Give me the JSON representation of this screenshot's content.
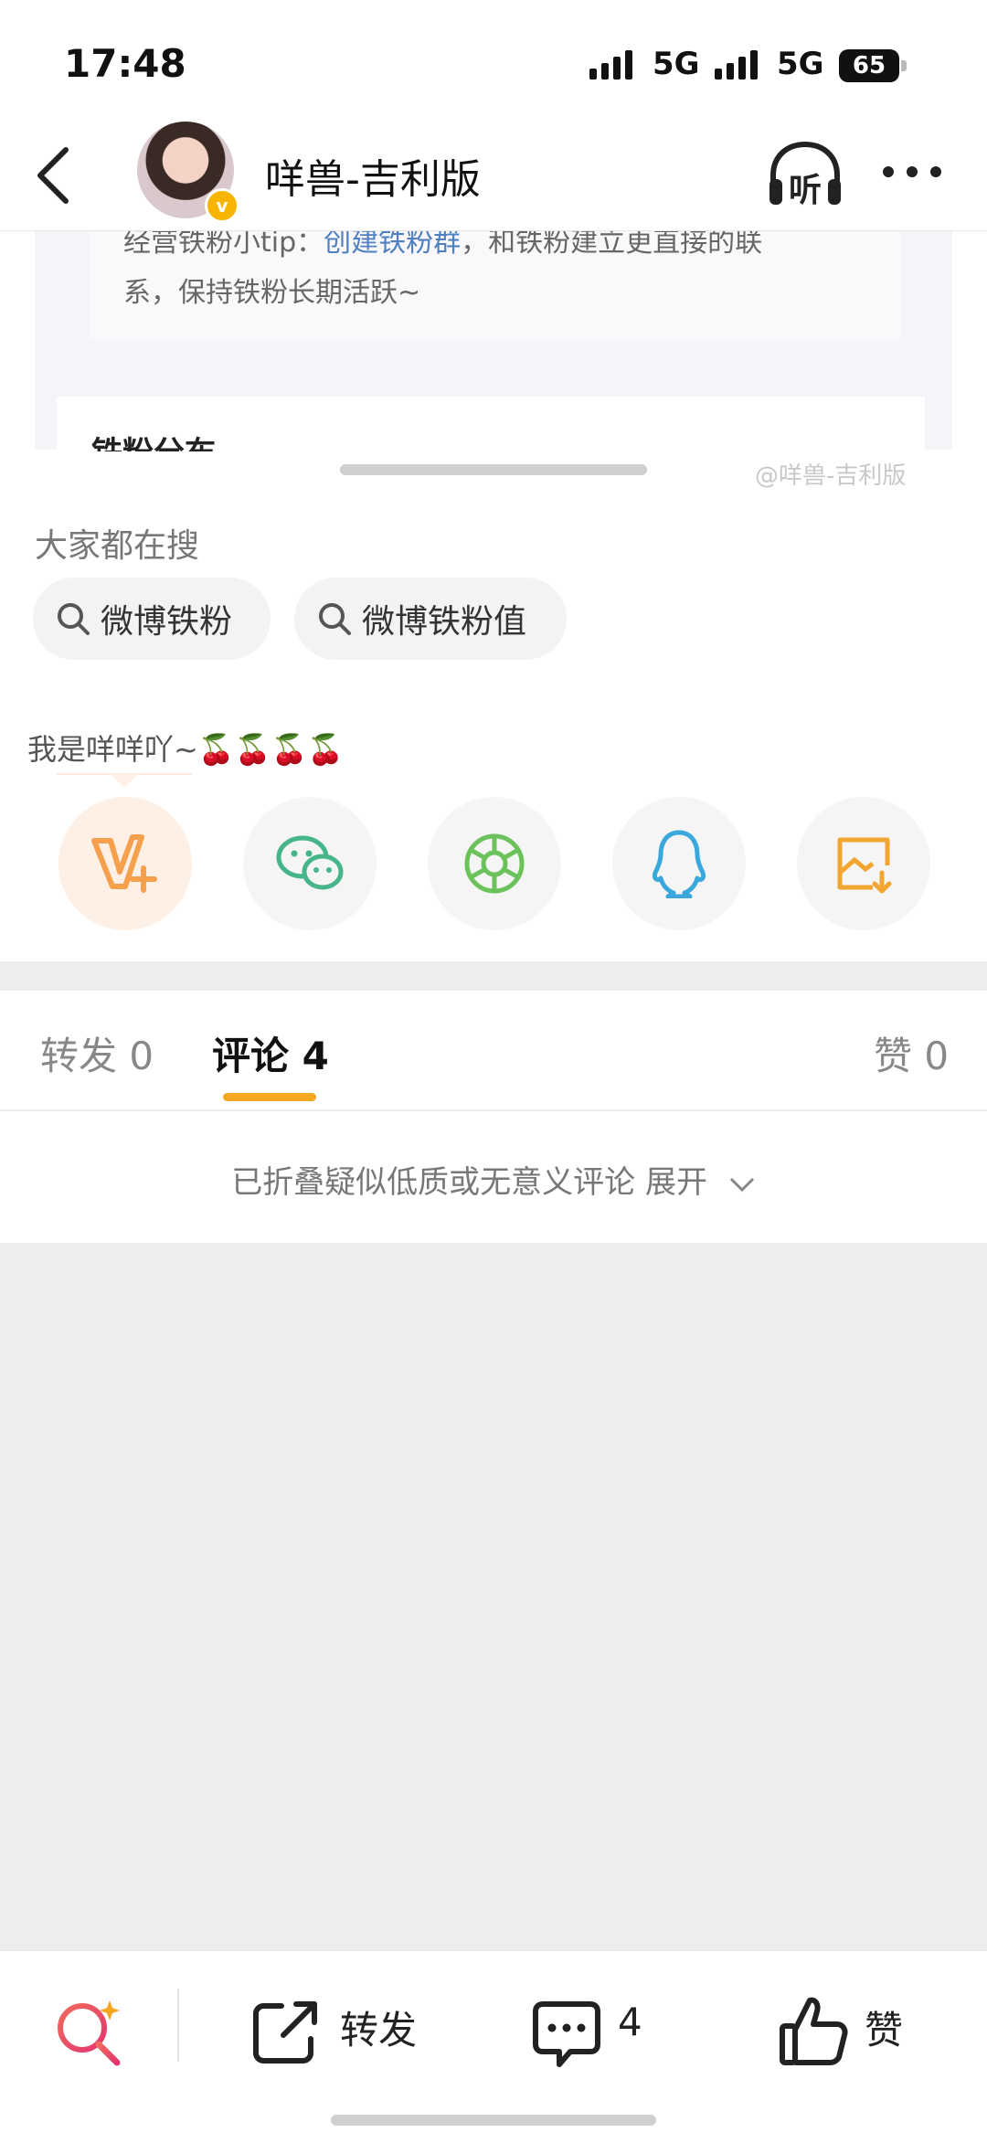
{
  "status_bar": {
    "time": "17:48",
    "network_1": "5G",
    "network_2": "5G",
    "battery": "65"
  },
  "header": {
    "title": "咩兽-吉利版",
    "listen_label": "听",
    "verified_badge": "v"
  },
  "embedded_image": {
    "line1_prefix": "经营铁粉小tip：",
    "line1_link": "创建铁粉群",
    "line1_suffix": "，和铁粉建立更直接的联",
    "line2": "系，保持铁粉长期活跃~",
    "section_title": "铁粉分布",
    "watermark": "@咩兽-吉利版"
  },
  "search": {
    "label": "大家都在搜",
    "chips": [
      "微博铁粉",
      "微博铁粉值"
    ]
  },
  "share": {
    "text": "我是咩咩吖~🍒🍒🍒🍒",
    "buttons": [
      {
        "name": "vplus-share",
        "icon": "v-plus-icon",
        "color": "#f5a04d"
      },
      {
        "name": "wechat-share",
        "icon": "wechat-icon",
        "color": "#46b58a"
      },
      {
        "name": "moments-share",
        "icon": "moments-icon",
        "color": "#6cc25a"
      },
      {
        "name": "qq-share",
        "icon": "qq-icon",
        "color": "#3aa8dd"
      },
      {
        "name": "save-image",
        "icon": "save-image-icon",
        "color": "#f3a531"
      }
    ]
  },
  "tabs": {
    "repost": "转发 0",
    "comment": "评论 4",
    "like": "赞 0"
  },
  "comments": {
    "folded_text": "已折叠疑似低质或无意义评论 展开"
  },
  "bottom_bar": {
    "repost_label": "转发",
    "comment_count": "4",
    "like_label": "赞"
  },
  "colors": {
    "accent": "#f5a623",
    "link": "#4e80c2"
  }
}
